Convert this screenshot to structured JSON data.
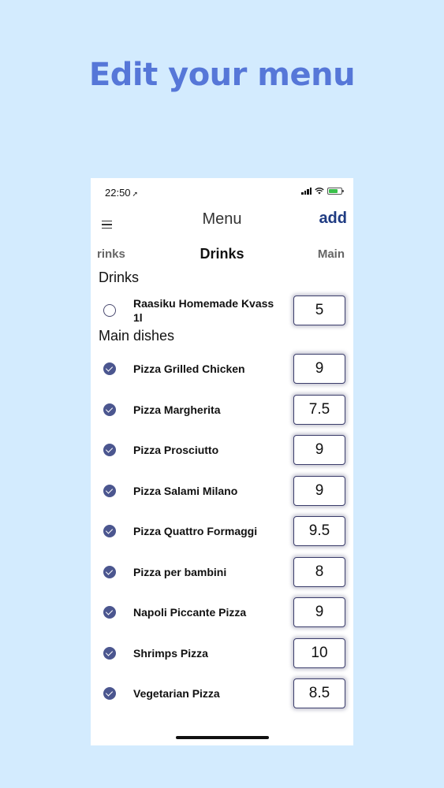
{
  "promo": {
    "title": "Edit your menu"
  },
  "status_bar": {
    "time": "22:50",
    "location_glyph": "➚"
  },
  "nav": {
    "title": "Menu",
    "add_label": "add"
  },
  "tabs": {
    "prev": "rinks",
    "current": "Drinks",
    "next": "Main"
  },
  "sections": [
    {
      "title": "Drinks",
      "items": [
        {
          "name": "Raasiku Homemade Kvass 1l",
          "price": "5",
          "selected": false
        }
      ]
    },
    {
      "title": "Main dishes",
      "items": [
        {
          "name": "Pizza Grilled Chicken",
          "price": "9",
          "selected": true
        },
        {
          "name": "Pizza Margherita",
          "price": "7.5",
          "selected": true
        },
        {
          "name": "Pizza Prosciutto",
          "price": "9",
          "selected": true
        },
        {
          "name": "Pizza Salami Milano",
          "price": "9",
          "selected": true
        },
        {
          "name": "Pizza Quattro Formaggi",
          "price": "9.5",
          "selected": true
        },
        {
          "name": "Pizza per bambini",
          "price": "8",
          "selected": true
        },
        {
          "name": "Napoli Piccante Pizza",
          "price": "9",
          "selected": true
        },
        {
          "name": "Shrimps Pizza",
          "price": "10",
          "selected": true
        },
        {
          "name": "Vegetarian Pizza",
          "price": "8.5",
          "selected": true
        }
      ]
    }
  ],
  "colors": {
    "background": "#d3ebfe",
    "promo_title": "#5677d8",
    "add_link": "#1f3b82",
    "check_fill": "#4b568f"
  }
}
